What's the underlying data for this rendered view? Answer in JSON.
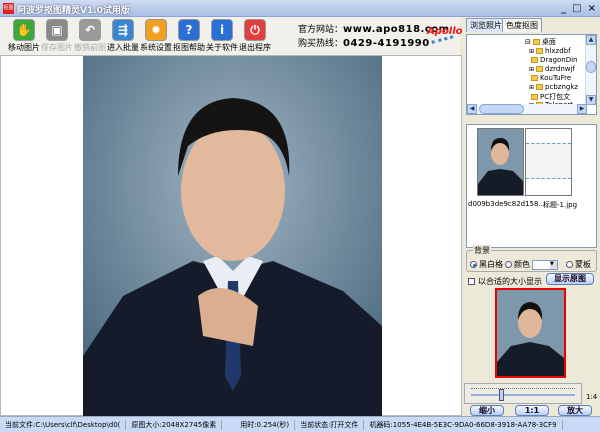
{
  "window": {
    "title": "阿波罗抠图精灵V1.0试用版",
    "app_icon_text": "抠图"
  },
  "toolbar": [
    {
      "label": "移动图片",
      "icon": "hand-icon",
      "color": "#3aa83a",
      "enabled": true
    },
    {
      "label": "保存图片",
      "icon": "floppy-icon",
      "color": "#8a8a8a",
      "enabled": false
    },
    {
      "label": "撤销前图",
      "icon": "undo-icon",
      "color": "#9a9a9a",
      "enabled": false
    },
    {
      "label": "进入批量",
      "icon": "batch-icon",
      "color": "#3a86d0",
      "enabled": true
    },
    {
      "label": "系统设置",
      "icon": "gear-icon",
      "color": "#f0a020",
      "enabled": true
    },
    {
      "label": "抠图帮助",
      "icon": "help-icon",
      "color": "#2a6fd6",
      "enabled": true
    },
    {
      "label": "关于软件",
      "icon": "info-icon",
      "color": "#2a6fd6",
      "enabled": true
    },
    {
      "label": "退出程序",
      "icon": "power-icon",
      "color": "#e04040",
      "enabled": true
    }
  ],
  "contact": {
    "site_label": "官方网站：",
    "site": "www.apo818.com",
    "phone_label": "购买热线：",
    "phone": "0429-4191990",
    "logo": "Apollo"
  },
  "tabs": [
    {
      "label": "浏览照片",
      "active": true
    },
    {
      "label": "色度抠图",
      "active": false
    }
  ],
  "tree": {
    "root": "桌面",
    "items": [
      "hlxzdbf",
      "DragonDin",
      "dzrdnwjf",
      "KouTuFre",
      "pcbzngkz",
      "PC打包文",
      "Teleport"
    ]
  },
  "thumbnails": [
    {
      "name": "d009b3de9c82d158..."
    },
    {
      "name": "标题-1.jpg"
    }
  ],
  "background": {
    "label": "背景",
    "options": [
      "黑白格",
      "颜色",
      "蒙板"
    ],
    "selected": "黑白格"
  },
  "fit_checkbox": {
    "label": "以合适的大小显示",
    "checked": false
  },
  "show_original_button": "显示原图",
  "zoom": {
    "ratio_label": "1:4",
    "slider_fraction": 0.27,
    "zoom_out": "缩小",
    "actual": "1:1",
    "zoom_in": "放大"
  },
  "status": {
    "file": "当前文件:C:\\Users\\clf\\Desktop\\d0(",
    "size": "原图大小:2048X2745像素",
    "time": "用时:0.254(秒)",
    "state": "当前状态:打开文件",
    "machine": "机器码:1055-4E4B-5E3C-9DA0-66D8-3918-AA78-3CF9"
  }
}
